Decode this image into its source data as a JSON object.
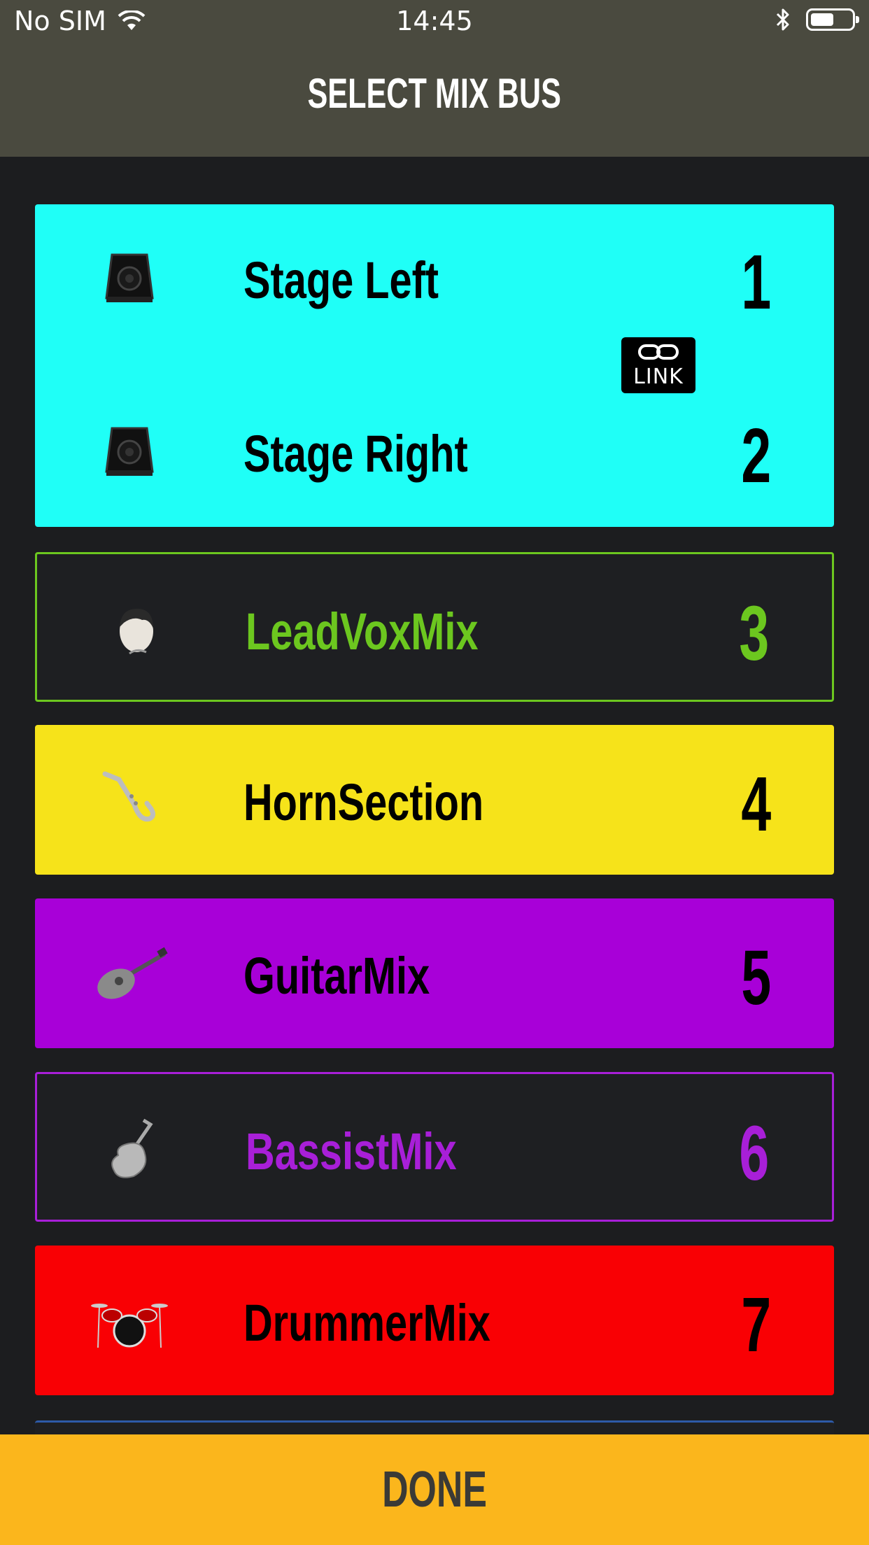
{
  "status": {
    "carrier": "No SIM",
    "time": "14:45"
  },
  "header": {
    "title": "SELECT MIX BUS"
  },
  "link_badge": "LINK",
  "buses": [
    {
      "name": "Stage Left",
      "number": "1",
      "icon": "stage-monitor-icon",
      "bg": "#1ffff7",
      "text": "#000000"
    },
    {
      "name": "Stage Right",
      "number": "2",
      "icon": "stage-monitor-icon",
      "bg": "#1ffff7",
      "text": "#000000"
    },
    {
      "name": "LeadVoxMix",
      "number": "3",
      "icon": "singer-face-icon",
      "bg": "#1e1f22",
      "text": "#6cc71f",
      "border": "#6cc71f"
    },
    {
      "name": "HornSection",
      "number": "4",
      "icon": "saxophone-icon",
      "bg": "#f6e31a",
      "text": "#000000"
    },
    {
      "name": "GuitarMix",
      "number": "5",
      "icon": "electric-guitar-icon",
      "bg": "#a800d8",
      "text": "#000000"
    },
    {
      "name": "BassistMix",
      "number": "6",
      "icon": "upright-bass-icon",
      "bg": "#1e1f22",
      "text": "#a81fd8",
      "border": "#a81fd8"
    },
    {
      "name": "DrummerMix",
      "number": "7",
      "icon": "drum-kit-icon",
      "bg": "#f90004",
      "text": "#000000"
    }
  ],
  "footer": {
    "done_label": "DONE"
  }
}
